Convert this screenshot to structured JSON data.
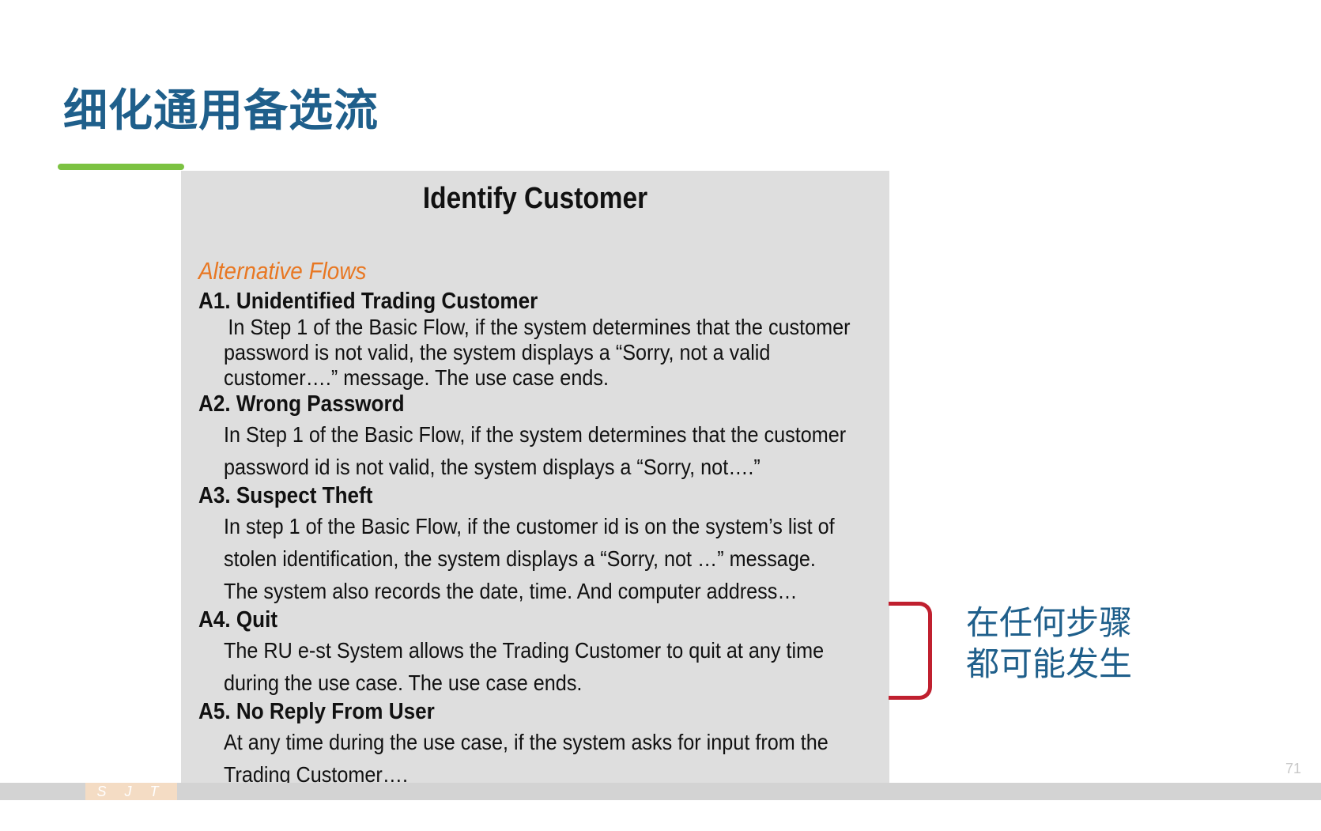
{
  "slide": {
    "title": "细化通用备选流",
    "page_number": "71",
    "footer_brand": "S J T U"
  },
  "box": {
    "title": "Identify Customer",
    "section_label": "Alternative Flows",
    "flows": [
      {
        "heading": "A1. Unidentified Trading Customer",
        "lines": [
          "In Step 1 of the Basic Flow, if the system determines that the customer",
          "password is not valid, the system displays a “Sorry, not a valid",
          "customer….” message. The use case ends."
        ]
      },
      {
        "heading": "A2. Wrong Password",
        "lines": [
          "In Step 1 of the Basic Flow, if the system determines that the customer",
          "password id is not valid, the system displays a “Sorry, not….”"
        ]
      },
      {
        "heading": "A3. Suspect Theft",
        "lines": [
          "In step 1 of the Basic Flow, if the customer id is on the system’s list of",
          "stolen identification, the system displays a “Sorry, not …” message.",
          "The system also records the date, time. And computer address…"
        ]
      },
      {
        "heading": "A4. Quit",
        "lines": [
          "The RU e-st System allows the Trading Customer to quit at any time",
          "during the use case. The use case ends."
        ]
      },
      {
        "heading": "A5. No Reply From User",
        "lines": [
          "At any time during the use case, if the system asks for input from the",
          "Trading Customer…."
        ]
      }
    ]
  },
  "side_note": {
    "lines": [
      "在任何步骤",
      "都可能发生"
    ]
  },
  "colors": {
    "title": "#1f5f8b",
    "underline": "#7cc242",
    "section_label": "#e87722",
    "bracket": "#c0202f",
    "box_background": "#dedede"
  }
}
